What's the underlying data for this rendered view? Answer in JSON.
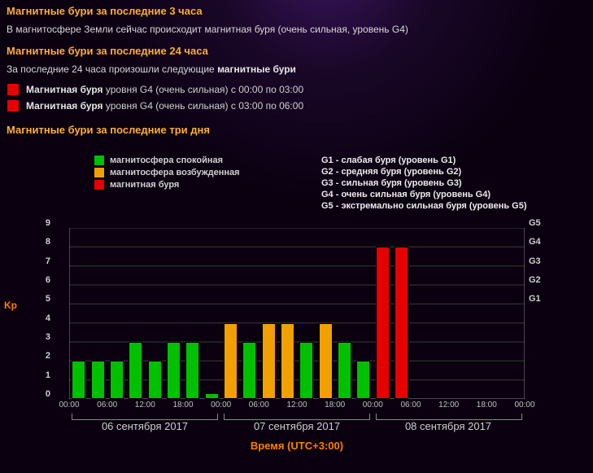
{
  "section3h": {
    "heading": "Магнитные бури за последние 3 часа",
    "status": "В магнитосфере Земли сейчас происходит магнитная буря (очень сильная, уровень G4)"
  },
  "section24h": {
    "heading": "Магнитные бури за последние 24 часа",
    "intro_pre": "За последние 24 часа произошли следующие ",
    "intro_bold": "магнитные бури",
    "events": [
      {
        "bold": "Магнитная буря",
        "text": " уровня G4 (очень сильная) с 00:00 по 03:00"
      },
      {
        "bold": "Магнитная буря",
        "text": " уровня G4 (очень сильная) с 03:00 по 06:00"
      }
    ]
  },
  "section3d": {
    "heading": "Магнитные бури за последние три дня"
  },
  "legend": {
    "calm": "магнитосфера спокойная",
    "excited": "магнитосфера возбужденная",
    "storm": "магнитная буря"
  },
  "glevels": {
    "g1": "G1 - слабая буря (уровень G1)",
    "g2": "G2 - средняя буря (уровень G2)",
    "g3": "G3 - сильная буря (уровень G3)",
    "g4": "G4 - очень сильная буря (уровень G4)",
    "g5": "G5 - экстремально сильная буря (уровень G5)"
  },
  "axis": {
    "kp": "Kp",
    "y0": "0",
    "y1": "1",
    "y2": "2",
    "y3": "3",
    "y4": "4",
    "y5": "5",
    "y6": "6",
    "y7": "7",
    "y8": "8",
    "y9": "9",
    "rG1": "G1",
    "rG2": "G2",
    "rG3": "G3",
    "rG4": "G4",
    "rG5": "G5",
    "xlabel": "Время (UTC+3:00)",
    "t00": "00:00",
    "t06": "06:00",
    "t12": "12:00",
    "t18": "18:00"
  },
  "days": {
    "d1": "06 сентября 2017",
    "d2": "07 сентября 2017",
    "d3": "08 сентября 2017"
  },
  "chart_data": {
    "type": "bar",
    "title": "Магнитные бури за последние три дня",
    "xlabel": "Время (UTC+3:00)",
    "ylabel": "Kp",
    "ylim": [
      0,
      9
    ],
    "right_axis_labels": {
      "5": "G1",
      "6": "G2",
      "7": "G3",
      "8": "G4",
      "9": "G5"
    },
    "categories": [
      "06 00:00",
      "06 03:00",
      "06 06:00",
      "06 09:00",
      "06 12:00",
      "06 15:00",
      "06 18:00",
      "06 21:00",
      "07 00:00",
      "07 03:00",
      "07 06:00",
      "07 09:00",
      "07 12:00",
      "07 15:00",
      "07 18:00",
      "07 21:00",
      "08 00:00",
      "08 03:00",
      "08 06:00",
      "08 09:00",
      "08 12:00",
      "08 15:00",
      "08 18:00",
      "08 21:00"
    ],
    "values": [
      2,
      2,
      2,
      3,
      2,
      3,
      3,
      0.3,
      4,
      3,
      4,
      4,
      3,
      4,
      3,
      2,
      8,
      8,
      null,
      null,
      null,
      null,
      null,
      null
    ],
    "colors": [
      "green",
      "green",
      "green",
      "green",
      "green",
      "green",
      "green",
      "green",
      "orange",
      "green",
      "orange",
      "orange",
      "green",
      "orange",
      "green",
      "green",
      "red",
      "red",
      null,
      null,
      null,
      null,
      null,
      null
    ],
    "color_map": {
      "green": "магнитосфера спокойная",
      "orange": "магнитосфера возбужденная",
      "red": "магнитная буря"
    }
  }
}
